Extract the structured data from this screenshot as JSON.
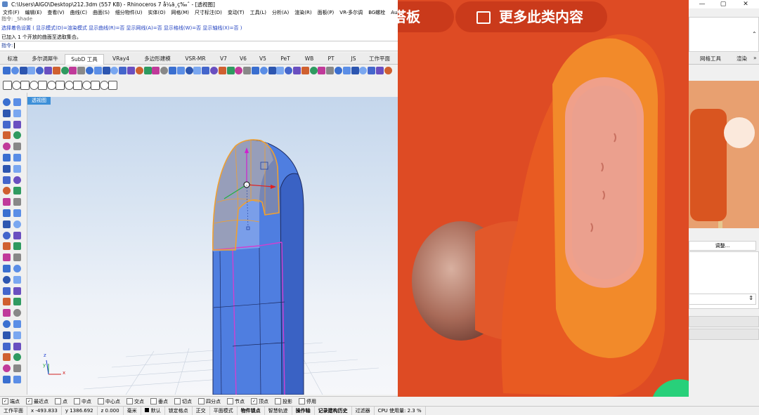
{
  "window": {
    "title": "C:\\Users\\AIGO\\Desktop\\212.3dm (557 KB) - Rhinoceros 7 å¼ä¸ç‰ˆ - [透视图]",
    "controls": [
      "—",
      "▢",
      "✕"
    ]
  },
  "menu": [
    "文件(F)",
    "编辑(E)",
    "查看(V)",
    "曲线(C)",
    "曲面(S)",
    "细分物件(U)",
    "实体(O)",
    "网格(M)",
    "尺寸标注(D)",
    "变动(T)",
    "工具(L)",
    "分析(A)",
    "渲染(R)",
    "面板(P)",
    "VR-多尔调",
    "BG螺栓",
    "Auxpecker"
  ],
  "command": {
    "history": [
      "指令: _Shade",
      "选择着色设置 ( 显示模式(D)=渲染模式  显示曲线(R)=否  显示网线(A)=否  显示格线(W)=否  显示轴线(X)=否 )",
      "已加入 1 个开放的曲面至选取集合。"
    ],
    "prompt": "指令:"
  },
  "tabs": [
    "标准",
    "多尔调犀牛",
    "SubD 工具",
    "VRay4",
    "多边形建模",
    "VSR-MR",
    "V7",
    "V6",
    "V5",
    "PeT",
    "WB",
    "PT",
    "JS",
    "工作平面"
  ],
  "active_tab": "SubD 工具",
  "viewport": {
    "label": "透视图",
    "axis_x": "x",
    "axis_y": "y",
    "axis_z": "z"
  },
  "osnaps": [
    {
      "label": "端点",
      "checked": true
    },
    {
      "label": "最近点",
      "checked": true
    },
    {
      "label": "点",
      "checked": false
    },
    {
      "label": "中点",
      "checked": false
    },
    {
      "label": "中心点",
      "checked": false
    },
    {
      "label": "交点",
      "checked": false
    },
    {
      "label": "垂点",
      "checked": false
    },
    {
      "label": "切点",
      "checked": false
    },
    {
      "label": "四分点",
      "checked": false
    },
    {
      "label": "节点",
      "checked": false
    },
    {
      "label": "顶点",
      "checked": true
    },
    {
      "label": "投影",
      "checked": false
    },
    {
      "label": "停用",
      "checked": false
    }
  ],
  "status": {
    "cplane": "工作平面",
    "x": "x -493.833",
    "y": "y 1386.692",
    "z": "z 0.000",
    "unit": "毫米",
    "layer": "默认",
    "toggles": [
      "锁定格点",
      "正交",
      "平面模式",
      "物件锁点",
      "智慧轨迹",
      "操作轴",
      "记录建构历史",
      "过滤器"
    ],
    "cpu": "CPU 使用量: 2.3 %"
  },
  "overlay": {
    "pill_left": "搭板",
    "pill_right": "更多此类内容"
  },
  "right_panel": {
    "tab1": "网格工具",
    "tab2": "渲染",
    "button": "调整..."
  },
  "colors": {
    "subd_blue": "#4f7ee0",
    "subd_edge_magenta": "#d040d0",
    "selected_orange": "#f0a030",
    "photo_bg": "#de4b24",
    "viewport_label": "#3c8fd8"
  }
}
